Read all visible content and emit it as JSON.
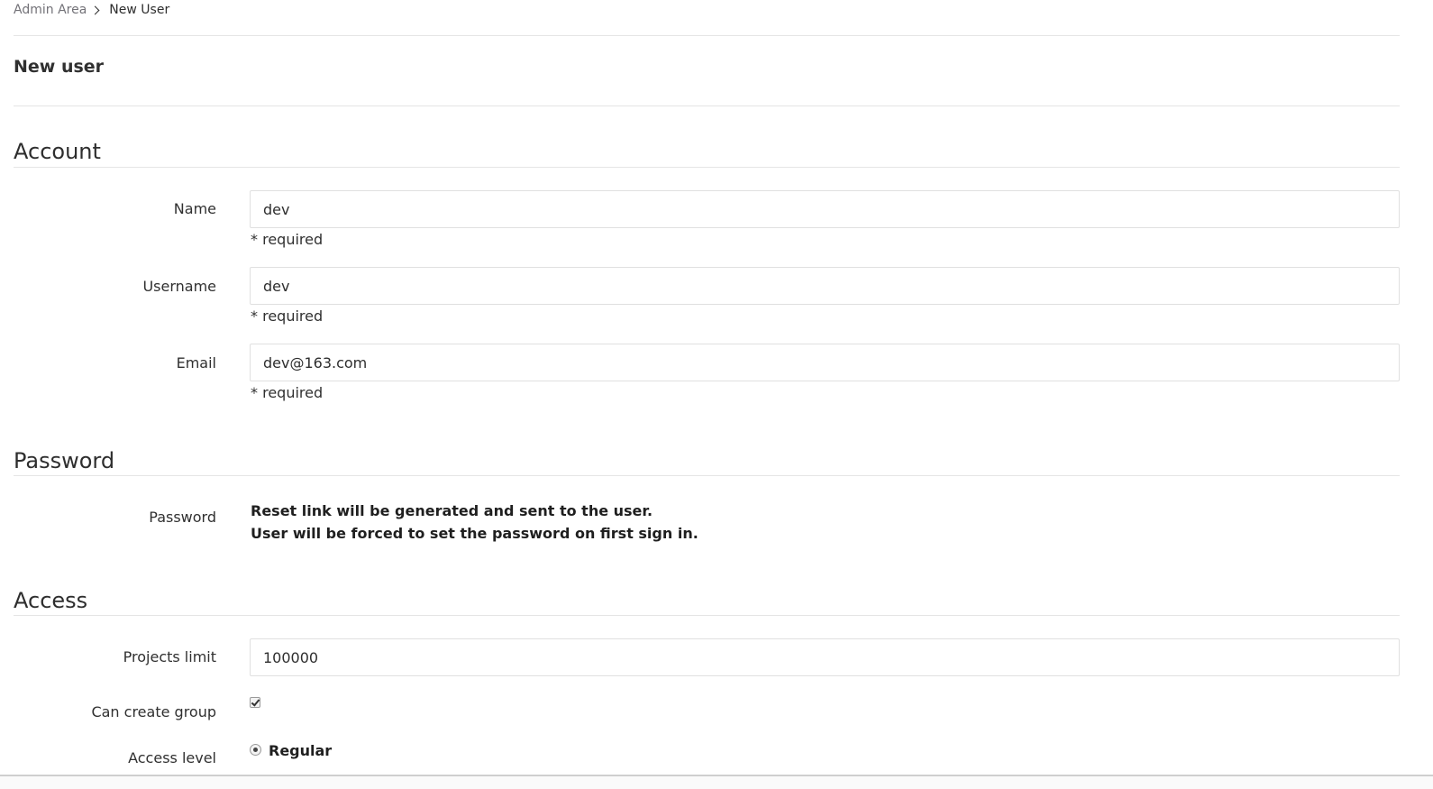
{
  "breadcrumb": {
    "parent": "Admin Area",
    "current": "New User"
  },
  "page_title": "New user",
  "sections": {
    "account": "Account",
    "password": "Password",
    "access": "Access"
  },
  "account": {
    "name_label": "Name",
    "name_value": "dev",
    "username_label": "Username",
    "username_value": "dev",
    "email_label": "Email",
    "email_value": "dev@163.com",
    "required_hint": "* required"
  },
  "password": {
    "label": "Password",
    "line1": "Reset link will be generated and sent to the user.",
    "line2": "User will be forced to set the password on first sign in."
  },
  "access": {
    "projects_limit_label": "Projects limit",
    "projects_limit_value": "100000",
    "can_create_group_label": "Can create group",
    "can_create_group_checked": true,
    "access_level_label": "Access level",
    "access_level_selected": "Regular"
  }
}
